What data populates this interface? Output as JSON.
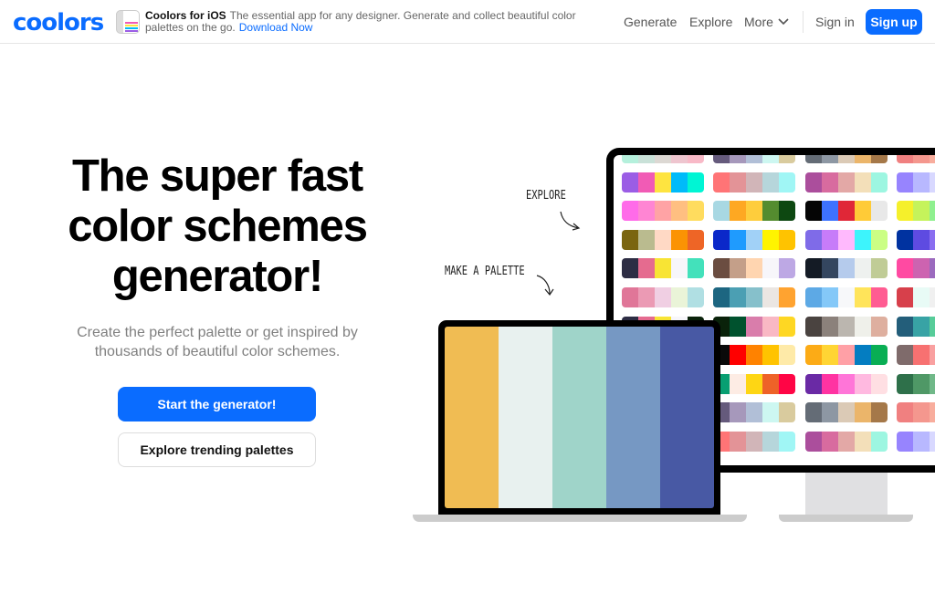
{
  "header": {
    "logo": "coolors",
    "promo_title": "Coolors for iOS",
    "promo_text": "The essential app for any designer. Generate and collect beautiful color palettes on the go.",
    "promo_link": "Download Now",
    "nav": [
      "Generate",
      "Explore",
      "More"
    ],
    "sign_in": "Sign in",
    "sign_up": "Sign up",
    "accent": "#0a6cff"
  },
  "hero": {
    "title_lines": [
      "The super fast",
      "color schemes",
      "generator!"
    ],
    "subtitle_lines": [
      "Create the perfect palette or get inspired by",
      "thousands of beautiful color schemes."
    ],
    "primary_button": "Start the generator!",
    "secondary_button": "Explore trending palettes"
  },
  "illustration": {
    "explore_label": "EXPLORE",
    "make_label": "MAKE A PALETTE",
    "laptop_palette": [
      "#f0bc53",
      "#e8f1ef",
      "#9fd4c9",
      "#7698c3",
      "#4859a4"
    ],
    "monitor_columns": [
      [
        [
          "#b5f0dc",
          "#c9e1d8",
          "#dcd8d3",
          "#eec5cf",
          "#f8b9c7"
        ],
        [
          "#9b5de5",
          "#f15bb5",
          "#fee440",
          "#00bbf9",
          "#00f5d4"
        ],
        [
          "#ff6be9",
          "#ff85d3",
          "#ffa3a5",
          "#ffbf81",
          "#ffdc5e"
        ],
        [
          "#7a6510",
          "#babb8f",
          "#ffd9c5",
          "#fb9304",
          "#ee6526"
        ],
        [
          "#2d2d44",
          "#e56b8f",
          "#f8e434",
          "#f7f6fa",
          "#43e1bb"
        ],
        [
          "#e07698",
          "#eb9ab4",
          "#f0cfe3",
          "#eaf4d8",
          "#b0dfe3"
        ],
        [
          "#2d2d44",
          "#e56b8f",
          "#f8e434",
          "#f7f6fa",
          "#0a220a"
        ],
        [
          "#7a6510",
          "#babb8f",
          "#ffd9c5",
          "#fb9304",
          "#0a0a0a"
        ],
        [
          "#ff6be9",
          "#ff85d3",
          "#ffa3a5",
          "#ffbf81",
          "#089f72"
        ],
        [
          "#b5f0dc",
          "#c9e1d8",
          "#dcd8d3",
          "#eec5cf",
          "#f8b9c7"
        ],
        [
          "#9b5de5",
          "#f15bb5",
          "#fee440",
          "#00bbf9",
          "#00f5d4"
        ]
      ],
      [
        [
          "#655a7c",
          "#a698bb",
          "#b1bfd7",
          "#cdf7f1",
          "#d9cb9e"
        ],
        [
          "#ff7476",
          "#e39397",
          "#d1b5b8",
          "#b6d6db",
          "#a0f6f5"
        ],
        [
          "#a8d8e3",
          "#fea822",
          "#fecd3c",
          "#548c2f",
          "#0d4811"
        ],
        [
          "#0b28c9",
          "#1f9bfe",
          "#a1d1f7",
          "#fff400",
          "#ffc300"
        ],
        [
          "#6b4d41",
          "#c49f89",
          "#ffd5b0",
          "#f7f6fa",
          "#bda8e4"
        ],
        [
          "#1d6681",
          "#4b9fb3",
          "#86c0cb",
          "#ebe6e2",
          "#ffa330"
        ],
        [
          "#0a220a",
          "#00522e",
          "#d97dab",
          "#f9b8c4",
          "#fed723"
        ],
        [
          "#0a0a0a",
          "#ff0000",
          "#ff8200",
          "#ffc300",
          "#feeaa8"
        ],
        [
          "#089f72",
          "#fdece4",
          "#fed614",
          "#ee6228",
          "#ff0545"
        ],
        [
          "#655a7c",
          "#a698bb",
          "#b1bfd7",
          "#cdf7f1",
          "#d9cb9e"
        ],
        [
          "#ff7476",
          "#e39397",
          "#d1b5b8",
          "#b6d6db",
          "#a0f6f5"
        ]
      ],
      [
        [
          "#646c76",
          "#8d97a3",
          "#dbcab6",
          "#ebb56a",
          "#a57849"
        ],
        [
          "#ab4e9c",
          "#d86b9f",
          "#e3a8a6",
          "#f3dfb9",
          "#9df6e1"
        ],
        [
          "#050505",
          "#3d72ff",
          "#e02737",
          "#ffcb37",
          "#e8e8e8"
        ],
        [
          "#7f6be8",
          "#c77cf9",
          "#ffb9fd",
          "#3df4fc",
          "#cbfe84"
        ],
        [
          "#141b25",
          "#34465f",
          "#b5cbec",
          "#eef1ef",
          "#c0cc96"
        ],
        [
          "#5da9e5",
          "#84c8f8",
          "#f7f8fa",
          "#ffe45a",
          "#ff5c92"
        ],
        [
          "#4a4340",
          "#8b817b",
          "#bbb6af",
          "#eff0ea",
          "#deaf9f"
        ],
        [
          "#fcab16",
          "#ffd534",
          "#ffa0a6",
          "#047dc1",
          "#09ae54"
        ],
        [
          "#6a2aa5",
          "#ff33a2",
          "#ff75d8",
          "#ffb9e0",
          "#ffdfe3"
        ],
        [
          "#646c76",
          "#8d97a3",
          "#dbcab6",
          "#ebb56a",
          "#a57849"
        ],
        [
          "#ab4e9c",
          "#d86b9f",
          "#e3a8a6",
          "#f3dfb9",
          "#9df6e1"
        ]
      ],
      [
        [
          "#f08080",
          "#f4978e",
          "#f8ad9d",
          "#fbc4ab",
          "#ffdab9"
        ],
        [
          "#9784fe",
          "#b8b8ff",
          "#d8d8ff",
          "#eeeeff",
          "#ffffff"
        ],
        [
          "#f5f02b",
          "#c5f35b",
          "#8ff08f",
          "#5cd6a0",
          "#3fb5b5"
        ],
        [
          "#0032a0",
          "#5e4be1",
          "#8a6ef0",
          "#b0a0f5",
          "#d0c8fa"
        ],
        [
          "#ff4aa2",
          "#cd63b0",
          "#9b6abe",
          "#6a70c8",
          "#4a78d0"
        ],
        [
          "#d7404b",
          "#e8fbf6",
          "#f0f0f0",
          "#c0c0c0",
          "#909090"
        ],
        [
          "#235e7a",
          "#38a3a5",
          "#57cc99",
          "#80ed99",
          "#c7f9cc"
        ],
        [
          "#7f6b6b",
          "#f77171",
          "#f9a0a0",
          "#fbc8c8",
          "#fde0e0"
        ],
        [
          "#2e704a",
          "#4f9866",
          "#70b888",
          "#98d0a8",
          "#c0e8c8"
        ],
        [
          "#f08080",
          "#f4978e",
          "#f8ad9d",
          "#fbc4ab",
          "#ffdab9"
        ],
        [
          "#9784fe",
          "#b8b8ff",
          "#d8d8ff",
          "#eeeeff",
          "#ffffff"
        ]
      ]
    ]
  }
}
